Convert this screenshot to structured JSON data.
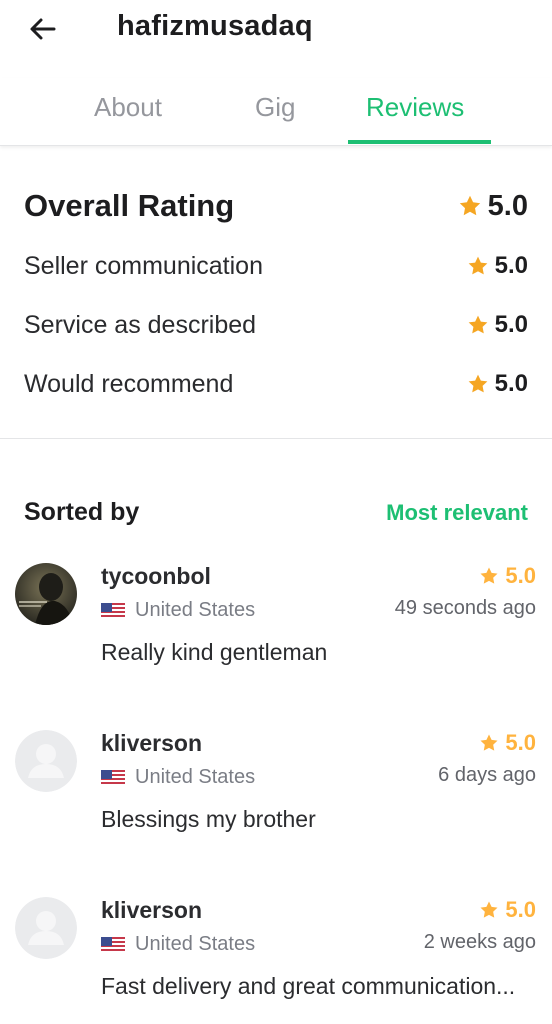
{
  "header": {
    "back_icon": "arrow-left-icon",
    "title": "hafizmusadaq"
  },
  "tabs": [
    {
      "label": "About",
      "active": false
    },
    {
      "label": "Gig",
      "active": false
    },
    {
      "label": "Reviews",
      "active": true
    }
  ],
  "overall": {
    "label": "Overall Rating",
    "value": "5.0",
    "breakdown": [
      {
        "label": "Seller communication",
        "value": "5.0"
      },
      {
        "label": "Service as described",
        "value": "5.0"
      },
      {
        "label": "Would recommend",
        "value": "5.0"
      }
    ]
  },
  "sort": {
    "label": "Sorted by",
    "value": "Most relevant"
  },
  "reviews": [
    {
      "username": "tycoonbol",
      "country": "United States",
      "rating": "5.0",
      "time": "49 seconds ago",
      "comment": "Really kind gentleman",
      "avatar": "photo"
    },
    {
      "username": "kliverson",
      "country": "United States",
      "rating": "5.0",
      "time": "6 days ago",
      "comment": "Blessings my brother",
      "avatar": "placeholder"
    },
    {
      "username": "kliverson",
      "country": "United States",
      "rating": "5.0",
      "time": "2 weeks ago",
      "comment": "Fast delivery and great communication...",
      "avatar": "placeholder"
    }
  ],
  "colors": {
    "accent": "#1dbf73",
    "star": "#ffb33e",
    "star_overall": "#f5a623"
  }
}
